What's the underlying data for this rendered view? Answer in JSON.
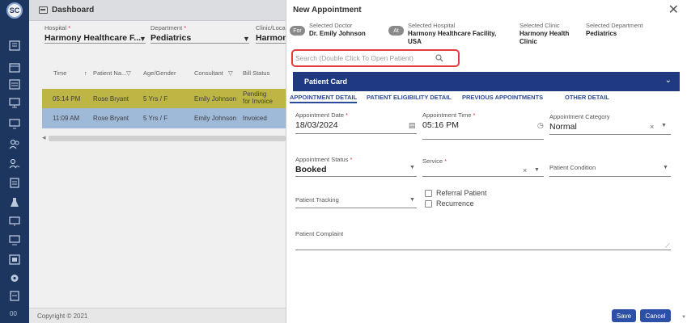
{
  "sidebar": {
    "logo": "SC",
    "icons": [
      "dashboard-icon",
      "calendar-icon",
      "list-icon",
      "monitor-icon",
      "screen-icon",
      "users-icon",
      "group-icon",
      "clipboard-icon",
      "flask-icon",
      "display-icon",
      "desktop-icon",
      "report-icon",
      "gear-icon",
      "document-icon"
    ],
    "bottom": "00"
  },
  "topbar": {
    "title": "Dashboard"
  },
  "filters": {
    "hospital_label": "Hospital",
    "hospital_value": "Harmony Healthcare F...",
    "department_label": "Department",
    "department_value": "Pediatrics",
    "clinic_label": "Clinic/Loca",
    "clinic_value": "Harmon"
  },
  "table": {
    "headers": [
      "Time",
      "Patient Na...",
      "Age/Gender",
      "Consultant",
      "Bill Status"
    ],
    "rows": [
      {
        "time": "05:14 PM",
        "patient": "Rose Bryant",
        "age": "5 Yrs / F",
        "consultant": "Emily Johnson",
        "status": "Pending for Invoice"
      },
      {
        "time": "11:09 AM",
        "patient": "Rose Bryant",
        "age": "5 Yrs / F",
        "consultant": "Emily Johnson",
        "status": "Invoiced"
      }
    ]
  },
  "footer": {
    "copyright": "Copyright © 2021"
  },
  "modal": {
    "title": "New Appointment",
    "for_pill": "For",
    "at_pill": "At",
    "selected_doctor_label": "Selected Doctor",
    "selected_doctor": "Dr. Emily Johnson",
    "selected_hospital_label": "Selected Hospital",
    "selected_hospital": "Harmony Healthcare Facility, USA",
    "selected_clinic_label": "Selected Clinic",
    "selected_clinic": "Harmony Health Clinic",
    "selected_department_label": "Selected Department",
    "selected_department": "Pediatrics",
    "search_placeholder": "Search (Double Click To Open Patient)",
    "patient_card": "Patient Card",
    "tabs": [
      "APPOINTMENT DETAIL",
      "PATIENT ELIGIBILITY DETAIL",
      "PREVIOUS APPOINTMENTS",
      "OTHER DETAIL"
    ],
    "appointment_date_label": "Appointment Date",
    "appointment_date": "18/03/2024",
    "appointment_time_label": "Appointment Time",
    "appointment_time": "05:16 PM",
    "appointment_category_label": "Appointment Category",
    "appointment_category": "Normal",
    "appointment_status_label": "Appointment Status",
    "appointment_status": "Booked",
    "service_label": "Service",
    "patient_condition_label": "Patient Condition",
    "patient_tracking_label": "Patient Tracking",
    "referral_patient": "Referral Patient",
    "recurrence": "Recurrence",
    "patient_complaint_label": "Patient Complaint",
    "save": "Save",
    "cancel": "Cancel"
  },
  "colors": {
    "sidebar": "#1f3a66",
    "accent": "#2c4fa8",
    "highlight": "#e53b3b",
    "row_pending": "#c9c24a",
    "row_invoiced": "#a9c5e6"
  }
}
